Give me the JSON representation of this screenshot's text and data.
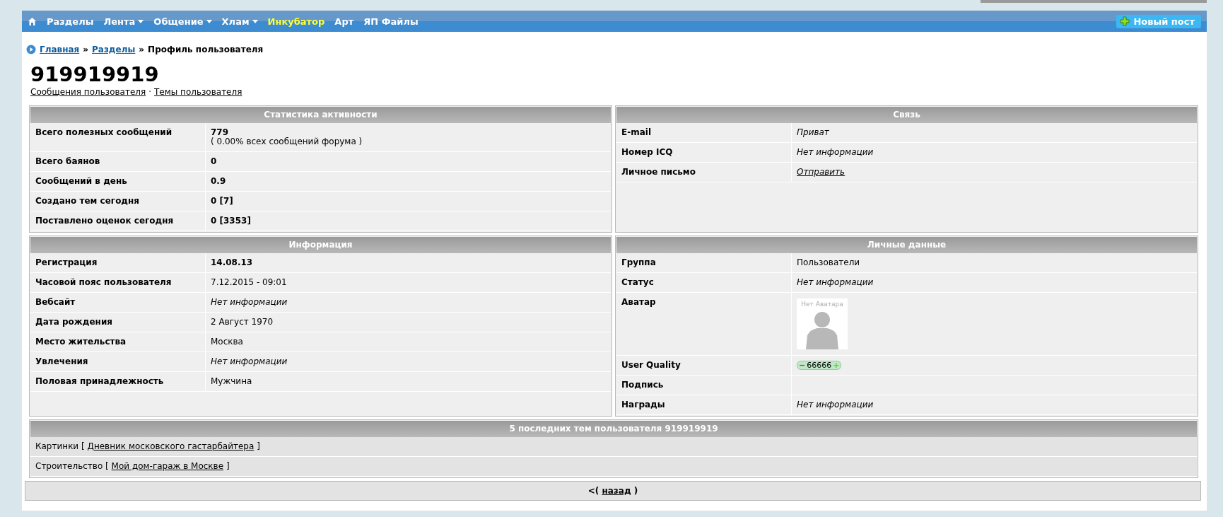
{
  "nav": {
    "items": [
      {
        "label": "Разделы",
        "dropdown": false,
        "highlight": false
      },
      {
        "label": "Лента",
        "dropdown": true,
        "highlight": false
      },
      {
        "label": "Общение",
        "dropdown": true,
        "highlight": false
      },
      {
        "label": "Хлам",
        "dropdown": true,
        "highlight": false
      },
      {
        "label": "Инкубатор",
        "dropdown": false,
        "highlight": true
      },
      {
        "label": "Арт",
        "dropdown": false,
        "highlight": false
      },
      {
        "label": "ЯП Файлы",
        "dropdown": false,
        "highlight": false
      }
    ],
    "new_post": "Новый пост"
  },
  "breadcrumb": {
    "links": [
      "Главная",
      "Разделы"
    ],
    "current": "Профиль пользователя",
    "separator": "»"
  },
  "username": "919919919",
  "user_links": [
    "Сообщения пользователя",
    "Темы пользователя"
  ],
  "user_links_separator": "·",
  "panels": [
    {
      "title": "Статистика активности",
      "rows": [
        {
          "label": "Всего полезных сообщений",
          "kind": "bold",
          "value": "779",
          "note": "( 0.00% всех сообщений форума )"
        },
        {
          "label": "Всего баянов",
          "kind": "bold",
          "value": "0"
        },
        {
          "label": "Сообщений в день",
          "kind": "bold",
          "value": "0.9"
        },
        {
          "label": "Создано тем сегодня",
          "kind": "bold",
          "value": "0 [7]"
        },
        {
          "label": "Поставлено оценок сегодня",
          "kind": "bold",
          "value": "0 [3353]"
        }
      ]
    },
    {
      "title": "Связь",
      "rows": [
        {
          "label": "E-mail",
          "kind": "italic",
          "value": "Приват"
        },
        {
          "label": "Номер ICQ",
          "kind": "italic",
          "value": "Нет информации"
        },
        {
          "label": "Личное письмо",
          "kind": "link",
          "value": "Отправить"
        }
      ]
    },
    {
      "title": "Информация",
      "rows": [
        {
          "label": "Регистрация",
          "kind": "bold",
          "value": "14.08.13"
        },
        {
          "label": "Часовой пояс пользователя",
          "kind": "plain",
          "value": "7.12.2015 - 09:01"
        },
        {
          "label": "Вебсайт",
          "kind": "italic",
          "value": "Нет информации"
        },
        {
          "label": "Дата рождения",
          "kind": "plain",
          "value": "2 Август 1970"
        },
        {
          "label": "Место жительства",
          "kind": "plain",
          "value": "Москва"
        },
        {
          "label": "Увлечения",
          "kind": "italic",
          "value": "Нет информации"
        },
        {
          "label": "Половая принадлежность",
          "kind": "plain",
          "value": "Мужчина"
        }
      ]
    },
    {
      "title": "Личные данные",
      "rows": [
        {
          "label": "Группа",
          "kind": "plain",
          "value": "Пользователи"
        },
        {
          "label": "Статус",
          "kind": "italic",
          "value": "Нет информации"
        },
        {
          "label": "Аватар",
          "kind": "avatar",
          "value": "Нет Аватара"
        },
        {
          "label": "User Quality",
          "kind": "rating",
          "value": "66666",
          "minus": "−",
          "plus": "+"
        },
        {
          "label": "Подпись",
          "kind": "plain",
          "value": ""
        },
        {
          "label": "Награды",
          "kind": "italic",
          "value": "Нет информации"
        }
      ]
    }
  ],
  "recent_topics": {
    "title": "5 последних тем пользователя 919919919",
    "rows": [
      {
        "section": "Картинки",
        "open": "[",
        "topic": "Дневник московского гастарбайтера",
        "close": "]"
      },
      {
        "section": "Строительство",
        "open": "[",
        "topic": "Мой дом-гараж в Москве",
        "close": "]"
      }
    ]
  },
  "back": {
    "prefix": "<(",
    "link": "назад",
    "suffix": ")"
  }
}
